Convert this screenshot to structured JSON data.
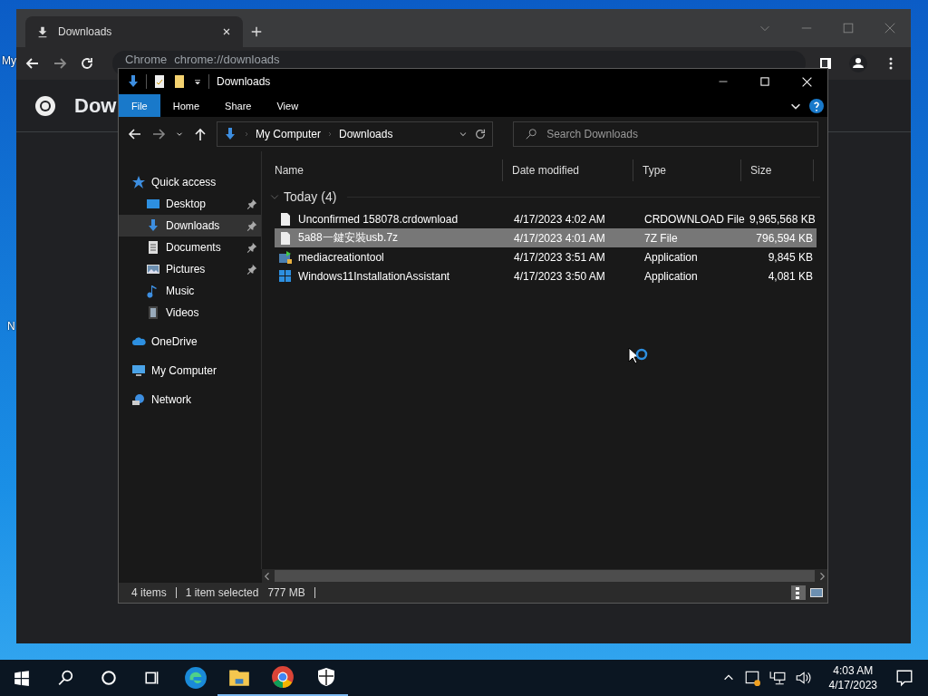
{
  "desktop": {
    "icon_labels": [
      "My",
      "N"
    ]
  },
  "browser": {
    "tab": {
      "title": "Downloads",
      "selected": true
    },
    "address": {
      "site": "Chrome",
      "url": "chrome://downloads"
    },
    "page_heading": "Dow"
  },
  "explorer": {
    "title": "Downloads",
    "ribbon_tabs": [
      {
        "label": "File",
        "selected": true
      },
      {
        "label": "Home",
        "selected": false
      },
      {
        "label": "Share",
        "selected": false
      },
      {
        "label": "View",
        "selected": false
      }
    ],
    "breadcrumb": [
      "My Computer",
      "Downloads"
    ],
    "search": {
      "placeholder": "Search Downloads"
    },
    "sidebar": [
      {
        "label": "Quick access",
        "kind": "star",
        "selected": false,
        "children": [
          {
            "label": "Desktop",
            "kind": "desktop",
            "pinned": true,
            "selected": false
          },
          {
            "label": "Downloads",
            "kind": "download",
            "pinned": true,
            "selected": true
          },
          {
            "label": "Documents",
            "kind": "documents",
            "pinned": true,
            "selected": false
          },
          {
            "label": "Pictures",
            "kind": "pictures",
            "pinned": true,
            "selected": false
          },
          {
            "label": "Music",
            "kind": "music",
            "pinned": false,
            "selected": false
          },
          {
            "label": "Videos",
            "kind": "videos",
            "pinned": false,
            "selected": false
          }
        ]
      },
      {
        "label": "OneDrive",
        "kind": "cloud",
        "selected": false
      },
      {
        "label": "My Computer",
        "kind": "computer",
        "selected": false
      },
      {
        "label": "Network",
        "kind": "network",
        "selected": false
      }
    ],
    "columns": [
      "Name",
      "Date modified",
      "Type",
      "Size"
    ],
    "group": "Today (4)",
    "files": [
      {
        "name": "Unconfirmed 158078.crdownload",
        "date": "4/17/2023 4:02 AM",
        "type": "CRDOWNLOAD File",
        "size": "9,965,568 KB",
        "kind": "file",
        "selected": false
      },
      {
        "name": "5a88一鍵安裝usb.7z",
        "date": "4/17/2023 4:01 AM",
        "type": "7Z File",
        "size": "796,594 KB",
        "kind": "file",
        "selected": true
      },
      {
        "name": "mediacreationtool",
        "date": "4/17/2023 3:51 AM",
        "type": "Application",
        "size": "9,845 KB",
        "kind": "setup",
        "selected": false
      },
      {
        "name": "Windows11InstallationAssistant",
        "date": "4/17/2023 3:50 AM",
        "type": "Application",
        "size": "4,081 KB",
        "kind": "windows",
        "selected": false
      }
    ],
    "status": {
      "count": "4 items",
      "selection": "1 item selected",
      "selection_size": "777 MB"
    }
  },
  "taskbar": {
    "apps": [
      {
        "kind": "edge",
        "running": false
      },
      {
        "kind": "explorer",
        "running": true
      },
      {
        "kind": "chrome",
        "running": true
      },
      {
        "kind": "shield",
        "running": true
      }
    ],
    "time": "4:03 AM",
    "date": "4/17/2023"
  }
}
